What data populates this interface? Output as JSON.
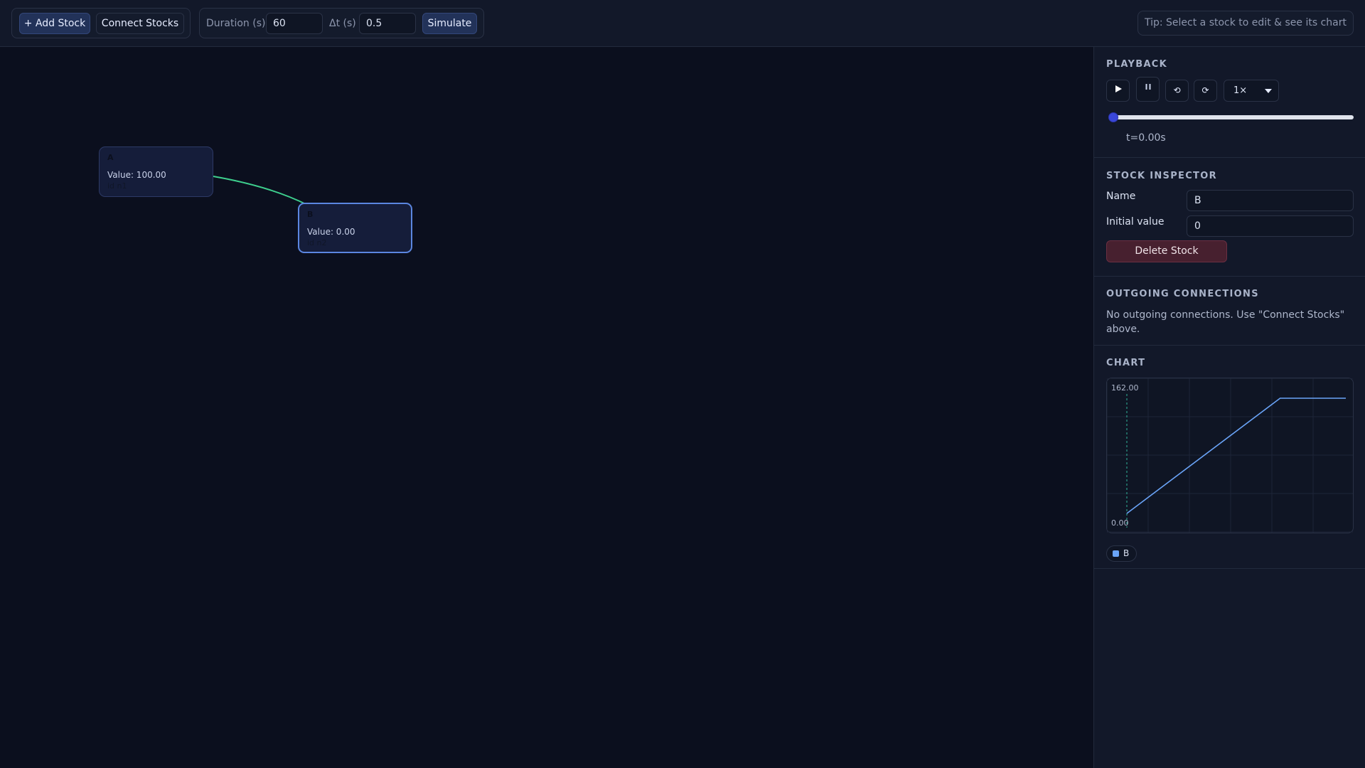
{
  "toolbar": {
    "add_stock": "+ Add Stock",
    "connect_stocks": "Connect Stocks",
    "duration_label": "Duration (s)",
    "duration_value": "60",
    "dt_label": "Δt (s)",
    "dt_value": "0.5",
    "simulate": "Simulate",
    "tip": "Tip: Select a stock to edit & see its chart"
  },
  "nodes": [
    {
      "name": "A",
      "value": "Value: 100.00",
      "id": "id n1",
      "selected": false
    },
    {
      "name": "B",
      "value": "Value: 0.00",
      "id": "id n2",
      "selected": true
    }
  ],
  "edge_color": "#3ecf8e",
  "playback": {
    "title": "PLAYBACK",
    "play_icon": "play-icon",
    "pause_icon": "pause-icon",
    "reset_icon": "rewind-icon",
    "loop_icon": "loop-icon",
    "speed": "1×",
    "progress": 0,
    "time": "t=0.00s"
  },
  "inspector": {
    "title": "STOCK INSPECTOR",
    "name_label": "Name",
    "name_value": "B",
    "initial_label": "Initial value",
    "initial_value": "0",
    "delete": "Delete Stock"
  },
  "connections": {
    "title": "OUTGOING CONNECTIONS",
    "note": "No outgoing connections. Use \"Connect Stocks\" above."
  },
  "chart": {
    "title": "CHART",
    "legend": "B"
  },
  "chart_data": {
    "type": "line",
    "ylim": [
      0,
      162
    ],
    "xlim": [
      0,
      60
    ],
    "ytick_top": "162.00",
    "ytick_bottom": "0.00",
    "grid": true,
    "cursor_x": 0,
    "series": [
      {
        "name": "B",
        "color": "#6aa4f8",
        "x": [
          0,
          42,
          60
        ],
        "y": [
          0,
          162,
          162
        ]
      }
    ]
  }
}
